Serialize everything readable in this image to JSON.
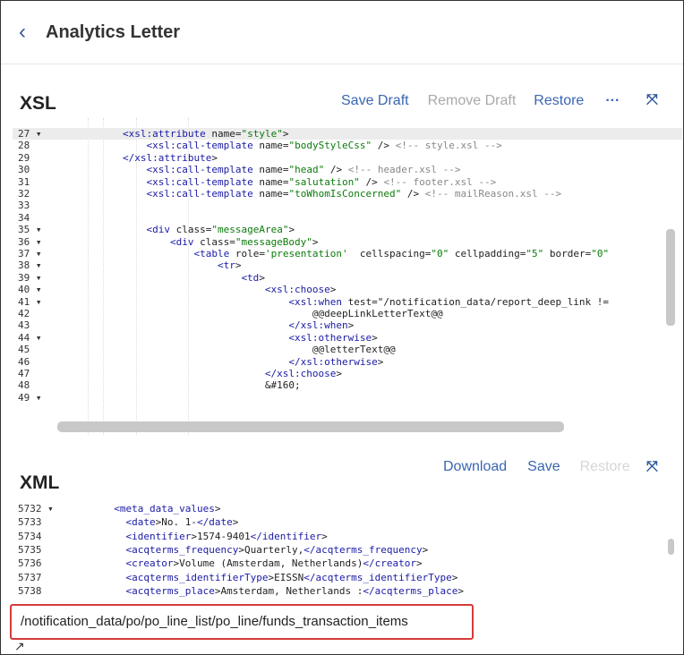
{
  "header": {
    "back_glyph": "‹",
    "title": "Analytics Letter"
  },
  "xsl": {
    "label": "XSL",
    "save_draft": "Save Draft",
    "remove_draft": "Remove Draft",
    "restore": "Restore",
    "more": "···",
    "lines": [
      {
        "n": "27 ▾",
        "t": "        <xsl:attribute name=\"style\">"
      },
      {
        "n": "28",
        "t": "            <xsl:call-template name=\"bodyStyleCss\" /> <!-- style.xsl -->"
      },
      {
        "n": "29",
        "t": "        </xsl:attribute>"
      },
      {
        "n": "30",
        "t": "            <xsl:call-template name=\"head\" /> <!-- header.xsl -->"
      },
      {
        "n": "31",
        "t": "            <xsl:call-template name=\"salutation\" /> <!-- footer.xsl -->"
      },
      {
        "n": "32",
        "t": "            <xsl:call-template name=\"toWhomIsConcerned\" /> <!-- mailReason.xsl -->"
      },
      {
        "n": "33",
        "t": ""
      },
      {
        "n": "34",
        "t": ""
      },
      {
        "n": "35 ▾",
        "t": "            <div class=\"messageArea\">"
      },
      {
        "n": "36 ▾",
        "t": "                <div class=\"messageBody\">"
      },
      {
        "n": "37 ▾",
        "t": "                    <table role='presentation'  cellspacing=\"0\" cellpadding=\"5\" border=\"0\""
      },
      {
        "n": "38 ▾",
        "t": "                        <tr>"
      },
      {
        "n": "39 ▾",
        "t": "                            <td>"
      },
      {
        "n": "40 ▾",
        "t": "                                <xsl:choose>"
      },
      {
        "n": "41 ▾",
        "t": "                                    <xsl:when test=\"/notification_data/report_deep_link !="
      },
      {
        "n": "42",
        "t": "                                        @@deepLinkLetterText@@"
      },
      {
        "n": "43",
        "t": "                                    </xsl:when>"
      },
      {
        "n": "44 ▾",
        "t": "                                    <xsl:otherwise>"
      },
      {
        "n": "45",
        "t": "                                        @@letterText@@"
      },
      {
        "n": "46",
        "t": "                                    </xsl:otherwise>"
      },
      {
        "n": "47",
        "t": "                                </xsl:choose>"
      },
      {
        "n": "48",
        "t": "                                &#160;"
      },
      {
        "n": "49 ▾",
        "t": ""
      }
    ]
  },
  "xml": {
    "label": "XML",
    "download": "Download",
    "save": "Save",
    "restore": "Restore",
    "lines": [
      {
        "n": "5732 ▾",
        "t": "  <meta_data_values>"
      },
      {
        "n": "5733",
        "t": "    <date>No. 1-</date>"
      },
      {
        "n": "5734",
        "t": "    <identifier>1574-9401</identifier>"
      },
      {
        "n": "5735",
        "t": "    <acqterms_frequency>Quarterly,</acqterms_frequency>"
      },
      {
        "n": "5736",
        "t": "    <creator>Volume (Amsterdam, Netherlands)</creator>"
      },
      {
        "n": "5737",
        "t": "    <acqterms_identifierType>EISSN</acqterms_identifierType>"
      },
      {
        "n": "5738",
        "t": "    <acqterms_place>Amsterdam, Netherlands :</acqterms_place>"
      }
    ]
  },
  "path": {
    "value": "/notification_data/po/po_line_list/po_line/funds_transaction_items"
  }
}
